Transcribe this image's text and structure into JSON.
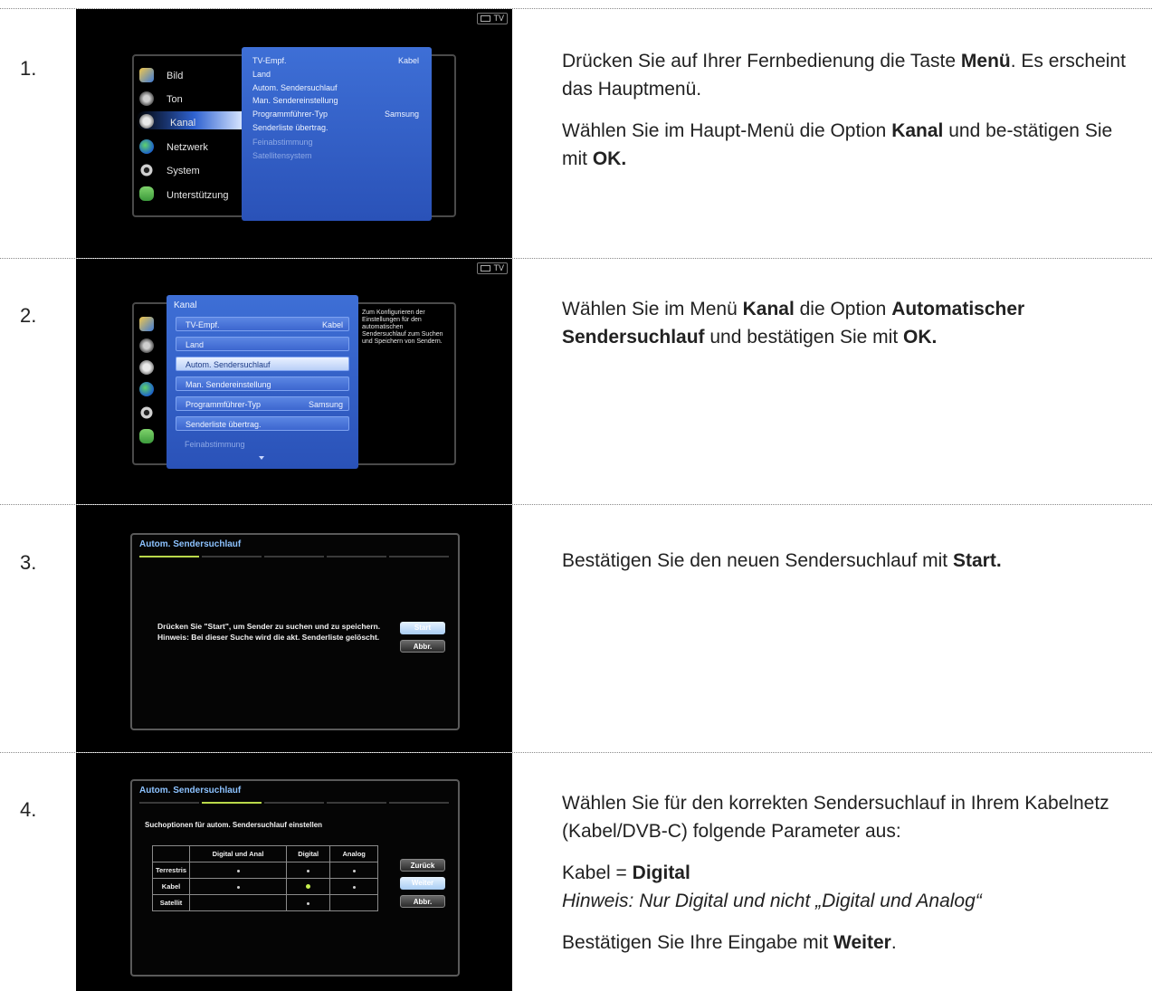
{
  "tv_badge": "TV",
  "steps": [
    {
      "number": "1.",
      "tv_menu": {
        "left_items": [
          "Bild",
          "Ton",
          "Kanal",
          "Netzwerk",
          "System",
          "Unterstützung"
        ],
        "panel_items": [
          {
            "label": "TV-Empf.",
            "value": "Kabel"
          },
          {
            "label": "Land",
            "value": ""
          },
          {
            "label": "Autom. Sendersuchlauf",
            "value": ""
          },
          {
            "label": "Man. Sendereinstellung",
            "value": ""
          },
          {
            "label": "Programmführer-Typ",
            "value": "Samsung"
          },
          {
            "label": "Senderliste übertrag.",
            "value": ""
          },
          {
            "label": "Feinabstimmung",
            "value": ""
          },
          {
            "label": "Satellitensystem",
            "value": ""
          }
        ]
      },
      "instruction": {
        "p1_a": "Drücken Sie auf Ihrer Fernbedienung die Taste ",
        "p1_b": "Menü",
        "p1_c": ". Es erscheint das Hauptmenü.",
        "p2_a": "Wählen Sie im Haupt-Menü die Option ",
        "p2_b": "Kanal",
        "p2_c": " und be-stätigen Sie mit ",
        "p2_d": "OK."
      }
    },
    {
      "number": "2.",
      "tv_menu": {
        "title": "Kanal",
        "items": [
          {
            "label": "TV-Empf.",
            "value": "Kabel"
          },
          {
            "label": "Land",
            "value": ""
          },
          {
            "label": "Autom. Sendersuchlauf",
            "value": ""
          },
          {
            "label": "Man. Sendereinstellung",
            "value": ""
          },
          {
            "label": "Programmführer-Typ",
            "value": "Samsung"
          },
          {
            "label": "Senderliste übertrag.",
            "value": ""
          },
          {
            "label": "Feinabstimmung",
            "value": ""
          }
        ],
        "help_text": "Zum Konfigurieren der Einstellungen für den automatischen Sendersuchlauf zum Suchen und Speichern von Sendern."
      },
      "instruction": {
        "a": "Wählen Sie im Menü ",
        "b": "Kanal",
        "c": " die Option ",
        "d": "Automatischer Sendersuchlauf",
        "e": " und bestätigen Sie mit ",
        "f": "OK."
      }
    },
    {
      "number": "3.",
      "tv_dialog": {
        "title": "Autom. Sendersuchlauf",
        "line1": "Drücken Sie \"Start\", um Sender zu suchen und zu speichern.",
        "line2": "Hinweis: Bei dieser Suche wird die akt. Senderliste gelöscht.",
        "btn_start": "Start",
        "btn_cancel": "Abbr."
      },
      "instruction": {
        "a": "Bestätigen Sie den neuen Sendersuchlauf mit ",
        "b": "Start."
      }
    },
    {
      "number": "4.",
      "tv_dialog": {
        "title": "Autom. Sendersuchlauf",
        "subtitle": "Suchoptionen für autom. Sendersuchlauf einstellen",
        "columns": [
          "Digital und Anal",
          "Digital",
          "Analog"
        ],
        "rows": [
          "Terrestris",
          "Kabel",
          "Satellit"
        ],
        "btn_back": "Zurück",
        "btn_next": "Weiter",
        "btn_cancel": "Abbr."
      },
      "instruction": {
        "p1": "Wählen Sie für den korrekten Sendersuchlauf in Ihrem Kabelnetz (Kabel/DVB-C) folgende Parameter aus:",
        "p2_a": "Kabel = ",
        "p2_b": "Digital",
        "p2_note": "Hinweis: Nur Digital und nicht „Digital und Analog“",
        "p3_a": "Bestätigen Sie Ihre Eingabe mit ",
        "p3_b": "Weiter",
        "p3_c": "."
      }
    }
  ]
}
